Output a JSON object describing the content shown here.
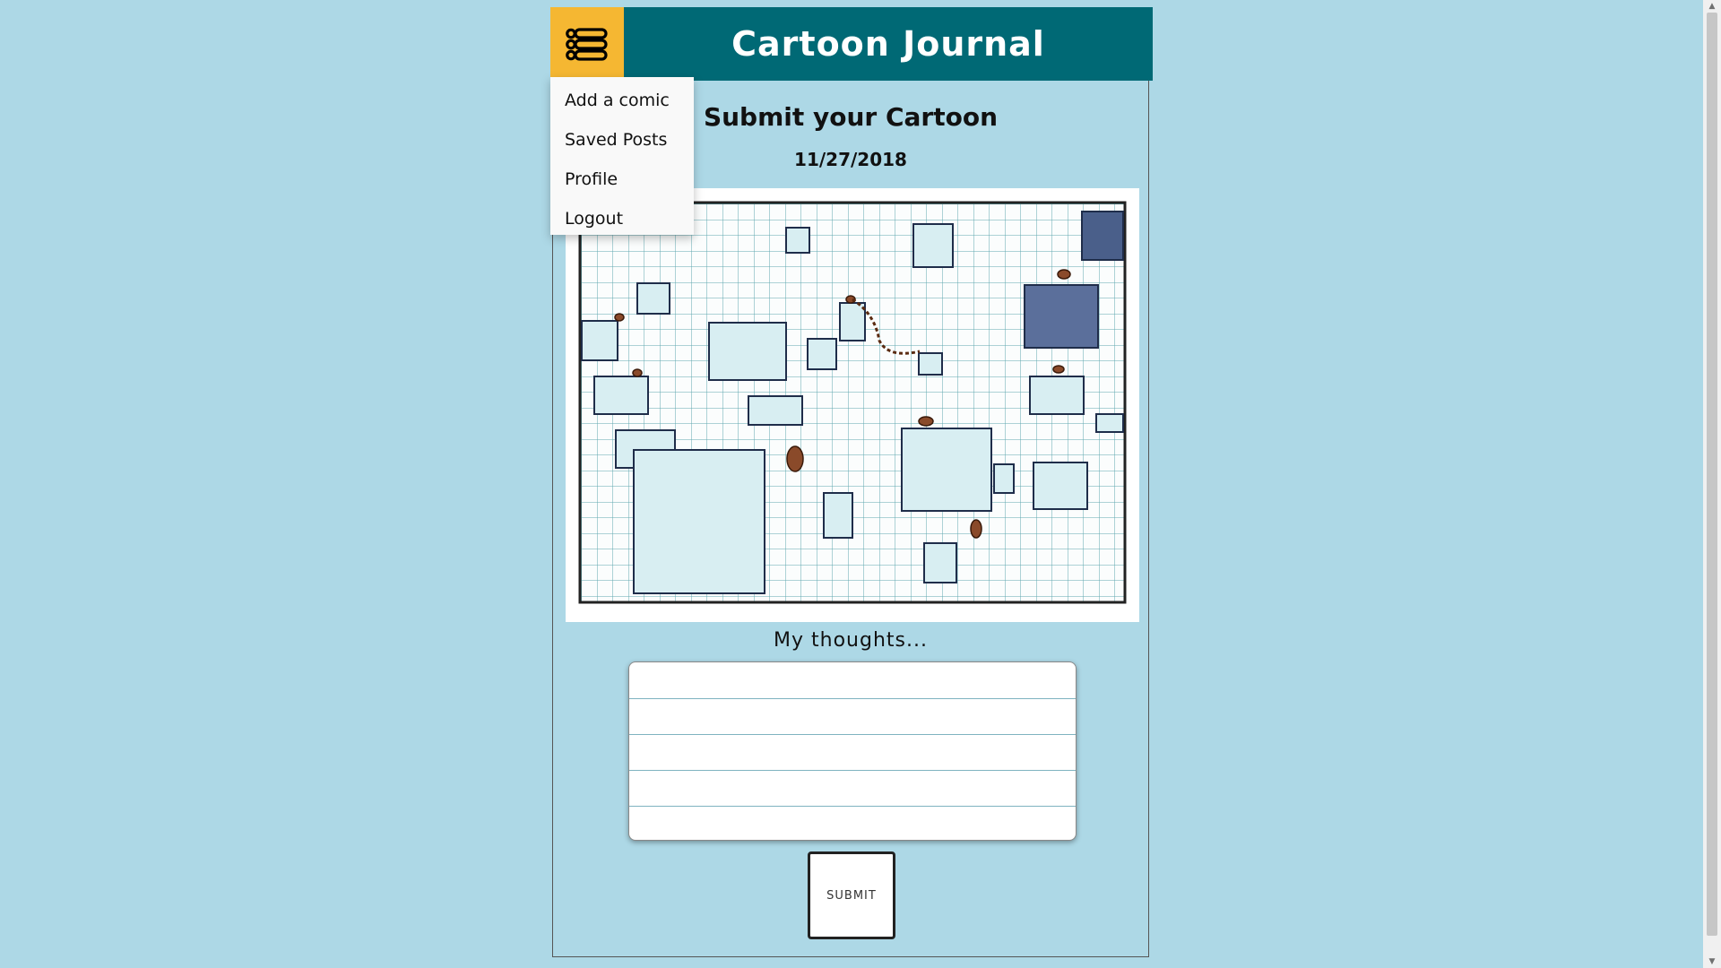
{
  "header": {
    "title": "Cartoon Journal",
    "menu_icon": "list-menu-icon",
    "brand_color": "#006975",
    "accent_color": "#f5b732"
  },
  "menu": {
    "items": [
      {
        "label": "Add a comic"
      },
      {
        "label": "Saved Posts"
      },
      {
        "label": "Profile"
      },
      {
        "label": "Logout"
      }
    ]
  },
  "main": {
    "title": "Submit your Cartoon",
    "date": "11/27/2018",
    "comic_image": "graph-paper-cubes-spiders-illustration",
    "thoughts_label": "My thoughts...",
    "thoughts_value": "",
    "submit_label": "SUBMIT"
  }
}
